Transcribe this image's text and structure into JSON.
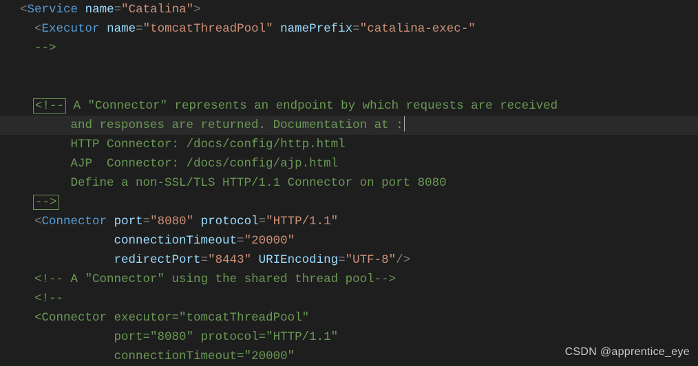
{
  "watermark": "CSDN @apprentice_eye",
  "tokens": {
    "lt": "<",
    "gt": ">",
    "slash_gt": "/>",
    "comment_open": "<!--",
    "comment_close": "-->",
    "close_comment_frag": "-->",
    "service_tag": "Service",
    "executor_tag": "Executor",
    "connector_tag": "Connector",
    "name_attr": "name",
    "namePrefix_attr": "namePrefix",
    "port_attr": "port",
    "protocol_attr": "protocol",
    "connectionTimeout_attr": "connectionTimeout",
    "redirectPort_attr": "redirectPort",
    "URIEncoding_attr": "URIEncoding",
    "executor_attr": "executor",
    "val_catalina": "\"Catalina\"",
    "val_tomcatThreadPool": "\"tomcatThreadPool\"",
    "val_catalina_exec": "\"catalina-exec-\"",
    "val_8080": "\"8080\"",
    "val_http11": "\"HTTP/1.1\"",
    "val_20000": "\"20000\"",
    "val_8443": "\"8443\"",
    "val_utf8": "\"UTF-8\"",
    "comment_connector_desc_1": " A \"Connector\" represents an endpoint by which requests are received",
    "comment_connector_desc_2": "and responses are returned. Documentation at :",
    "comment_http_connector": "HTTP Connector: /docs/config/http.html",
    "comment_ajp_connector": "AJP  Connector: /docs/config/ajp.html",
    "comment_define_nonssl": "Define a non-SSL/TLS HTTP/1.1 Connector on port 8080",
    "comment_shared_pool": " A \"Connector\" using the shared thread pool"
  }
}
